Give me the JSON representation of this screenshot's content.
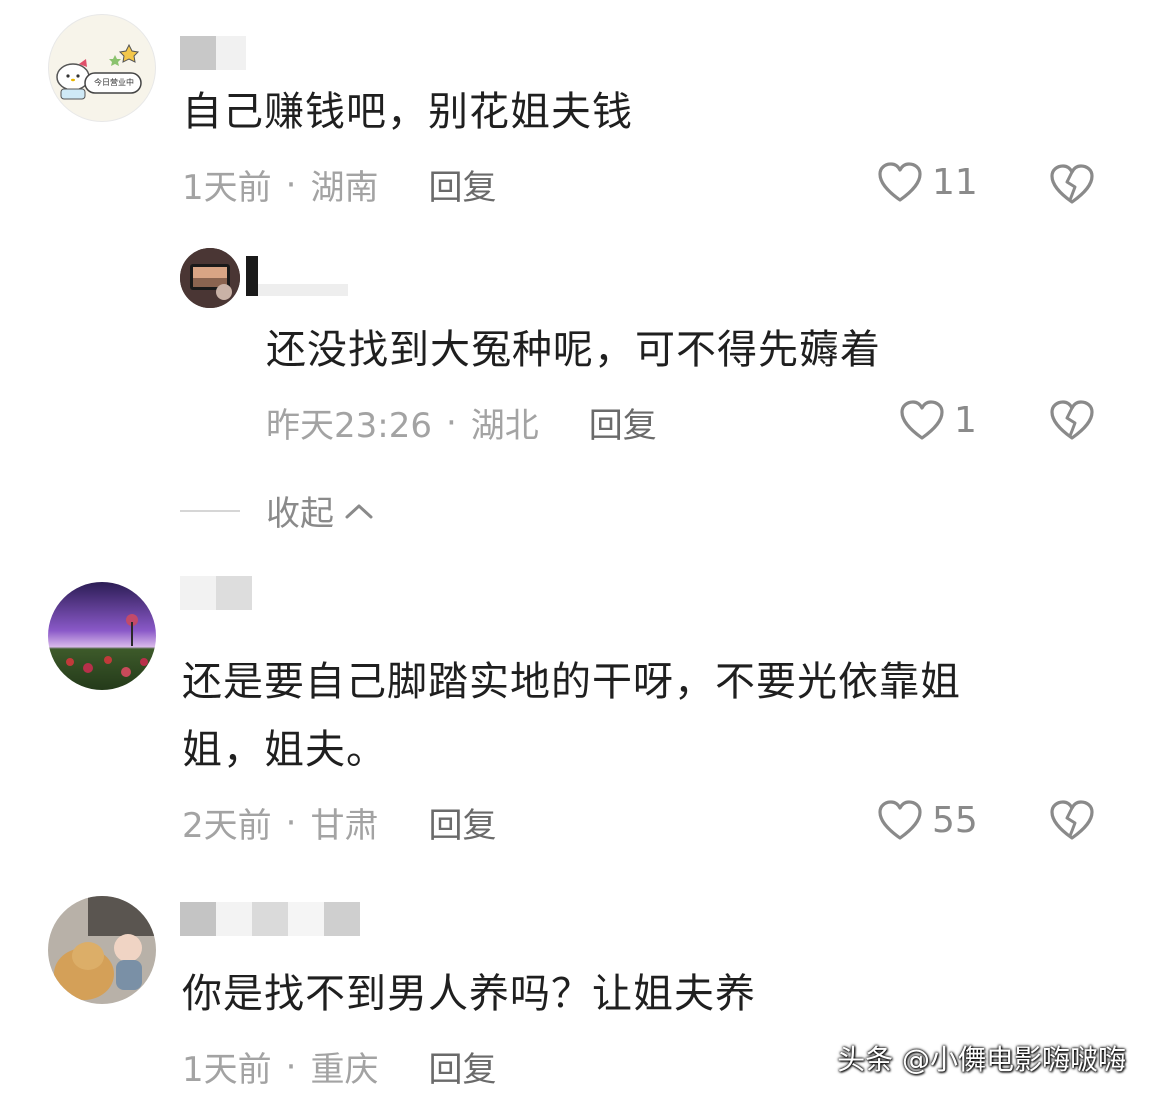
{
  "colors": {
    "text": "#1f1f1f",
    "meta": "#a3a3a3",
    "reply": "#6a6a6a",
    "icon": "#8a8a8a"
  },
  "comments": [
    {
      "avatar_icon": "hello-kitty-avatar",
      "avatar_badge": "今日营业中",
      "text": "自己赚钱吧，别花姐夫钱",
      "time": "1天前",
      "location": "湖南",
      "reply_label": "回复",
      "likes": "11"
    },
    {
      "avatar_icon": "photo-avatar",
      "text": "还没找到大冤种呢，可不得先薅着",
      "time": "昨天23:26",
      "location": "湖北",
      "reply_label": "回复",
      "likes": "1",
      "collapse_label": "收起"
    },
    {
      "avatar_icon": "purple-sky-rose-avatar",
      "text_line1": "还是要自己脚踏实地的干呀，不要光依靠姐",
      "text_line2": "姐，姐夫。",
      "time": "2天前",
      "location": "甘肃",
      "reply_label": "回复",
      "likes": "55"
    },
    {
      "avatar_icon": "dog-and-child-avatar",
      "text": "你是找不到男人养吗？让姐夫养",
      "time": "1天前",
      "location": "重庆",
      "reply_label": "回复"
    }
  ],
  "separator": "·",
  "watermark": "头条 @小儛电影嗨啵嗨"
}
